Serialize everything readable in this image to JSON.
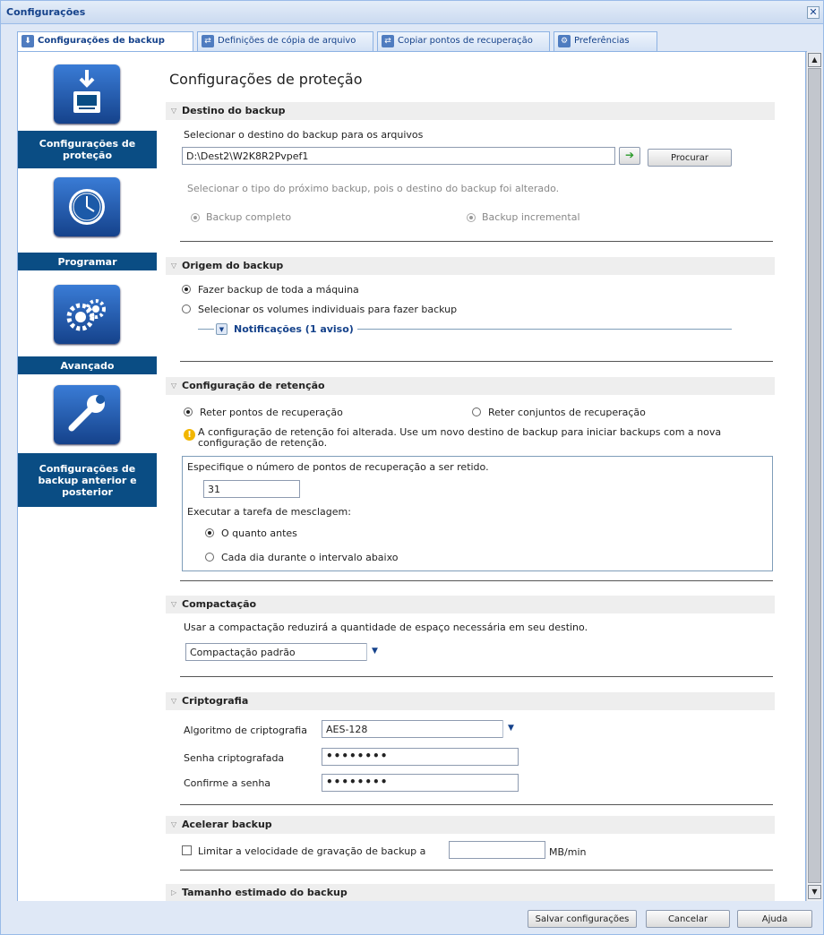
{
  "window": {
    "title": "Configurações",
    "close_icon": "close-icon"
  },
  "tabs": [
    {
      "label": "Configurações de backup",
      "icon": "backup-icon"
    },
    {
      "label": "Definições de cópia de arquivo",
      "icon": "file-copy-icon"
    },
    {
      "label": "Copiar pontos de recuperação",
      "icon": "copy-recovery-icon"
    },
    {
      "label": "Preferências",
      "icon": "preferences-icon"
    }
  ],
  "sidebar": {
    "items": [
      {
        "label": "Configurações de proteção",
        "icon": "drive-download-icon"
      },
      {
        "label": "Programar",
        "icon": "clock-icon"
      },
      {
        "label": "Avançado",
        "icon": "gears-icon"
      },
      {
        "label": "Configurações de backup anterior e posterior",
        "icon": "wrench-icon"
      }
    ]
  },
  "main": {
    "title": "Configurações de proteção",
    "destination": {
      "header": "Destino do backup",
      "prompt": "Selecionar o destino do backup para os arquivos",
      "path_value": "D:\\Dest2\\W2K8R2Pvpef1",
      "browse_label": "Procurar",
      "note": "Selecionar o tipo do próximo backup, pois o destino do backup foi alterado.",
      "full_label": "Backup completo",
      "incremental_label": "Backup incremental"
    },
    "source": {
      "header": "Origem do backup",
      "whole_machine_label": "Fazer backup de toda a máquina",
      "volumes_label": "Selecionar os volumes individuais para fazer backup",
      "notifications_label": "Notificações (1 aviso)"
    },
    "retention": {
      "header": "Configuração de retenção",
      "keep_points_label": "Reter pontos de recuperação",
      "keep_sets_label": "Reter conjuntos de recuperação",
      "warning": "A configuração de retenção foi alterada. Use um novo destino de backup para iniciar backups com a nova configuração de retenção.",
      "count_prompt": "Especifique o número de pontos de recuperação a ser retido.",
      "count_value": "31",
      "merge_prompt": "Executar a tarefa de mesclagem:",
      "asap_label": "O quanto antes",
      "interval_label": "Cada dia durante o intervalo abaixo"
    },
    "compression": {
      "header": "Compactação",
      "note": "Usar a compactação reduzirá a quantidade de espaço necessária em seu destino.",
      "selected": "Compactação padrão"
    },
    "encryption": {
      "header": "Criptografia",
      "algorithm_label": "Algoritmo de criptografia",
      "algorithm_value": "AES-128",
      "password_label": "Senha criptografada",
      "password_value": "••••••••",
      "confirm_label": "Confirme a senha",
      "confirm_value": "••••••••"
    },
    "throttle": {
      "header": "Acelerar backup",
      "limit_label": "Limitar a velocidade de gravação de backup a",
      "unit": "MB/min"
    },
    "estimate": {
      "header": "Tamanho estimado do backup"
    }
  },
  "footer": {
    "save_label": "Salvar configurações",
    "cancel_label": "Cancelar",
    "help_label": "Ajuda"
  }
}
